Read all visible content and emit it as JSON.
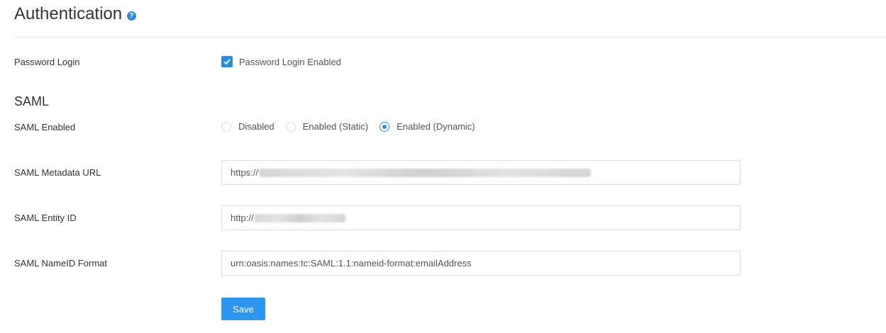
{
  "header": {
    "title": "Authentication",
    "help_icon": "help-circle-icon"
  },
  "password_login": {
    "label": "Password Login",
    "checkbox_label": "Password Login Enabled",
    "checked": true
  },
  "saml": {
    "section_title": "SAML",
    "enabled": {
      "label": "SAML Enabled",
      "options": [
        "Disabled",
        "Enabled (Static)",
        "Enabled (Dynamic)"
      ],
      "selected": "Enabled (Dynamic)"
    },
    "metadata_url": {
      "label": "SAML Metadata URL",
      "value_prefix": "https://"
    },
    "entity_id": {
      "label": "SAML Entity ID",
      "value_prefix": "http://"
    },
    "nameid_format": {
      "label": "SAML NameID Format",
      "value": "urn:oasis:names:tc:SAML:1.1:nameid-format:emailAddress"
    }
  },
  "actions": {
    "save_label": "Save"
  },
  "colors": {
    "accent": "#2b8ce0",
    "button": "#2b95ef"
  }
}
